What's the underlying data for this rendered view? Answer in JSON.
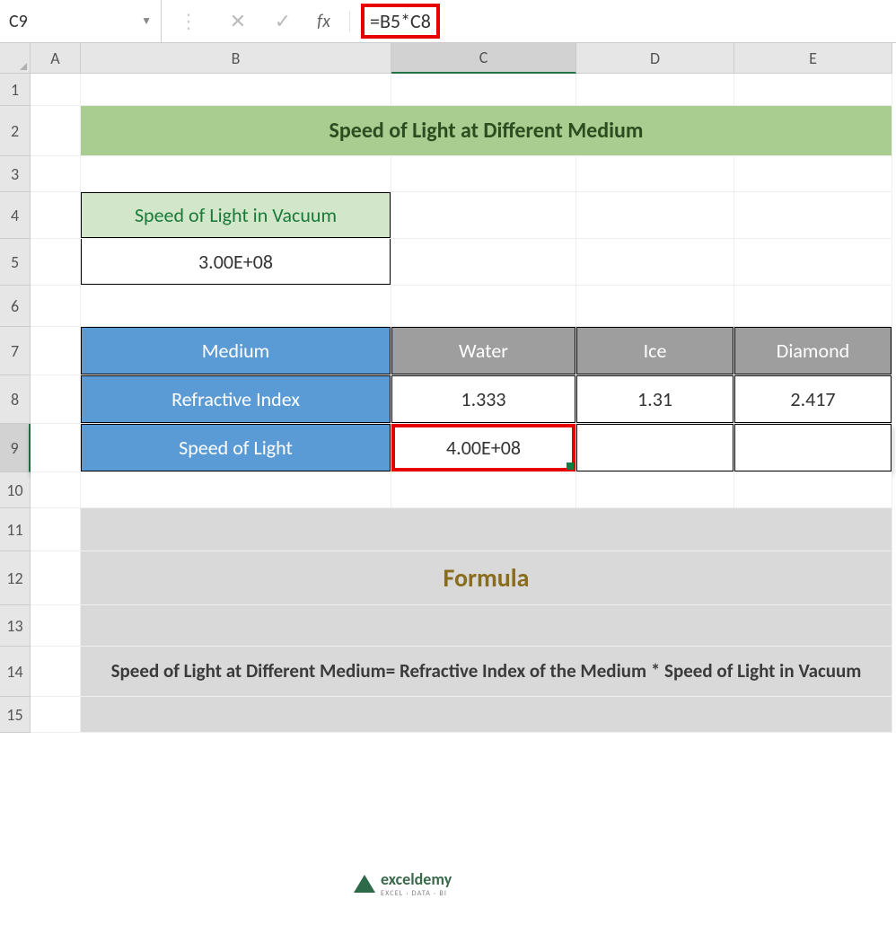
{
  "nameBox": "C9",
  "formulaBar": "=B5*C8",
  "columns": [
    "A",
    "B",
    "C",
    "D",
    "E"
  ],
  "rows": [
    "1",
    "2",
    "3",
    "4",
    "5",
    "6",
    "7",
    "8",
    "9",
    "10",
    "11",
    "12",
    "13",
    "14",
    "15"
  ],
  "activeCol": "C",
  "activeRow": "9",
  "title": "Speed of Light at Different Medium",
  "vacuum": {
    "label": "Speed of Light in Vacuum",
    "value": "3.00E+08"
  },
  "table": {
    "rowHeaders": [
      "Medium",
      "Refractive Index",
      "Speed of Light"
    ],
    "mediums": [
      "Water",
      "Ice",
      "Diamond"
    ],
    "refractive": [
      "1.333",
      "1.31",
      "2.417"
    ],
    "speed": [
      "4.00E+08",
      "",
      ""
    ]
  },
  "formulaBox": {
    "heading": "Formula",
    "text": "Speed of Light at Different Medium= Refractive Index of the Medium * Speed of Light in Vacuum"
  },
  "watermark": {
    "brand": "exceldemy",
    "tagline": "EXCEL · DATA · BI"
  }
}
